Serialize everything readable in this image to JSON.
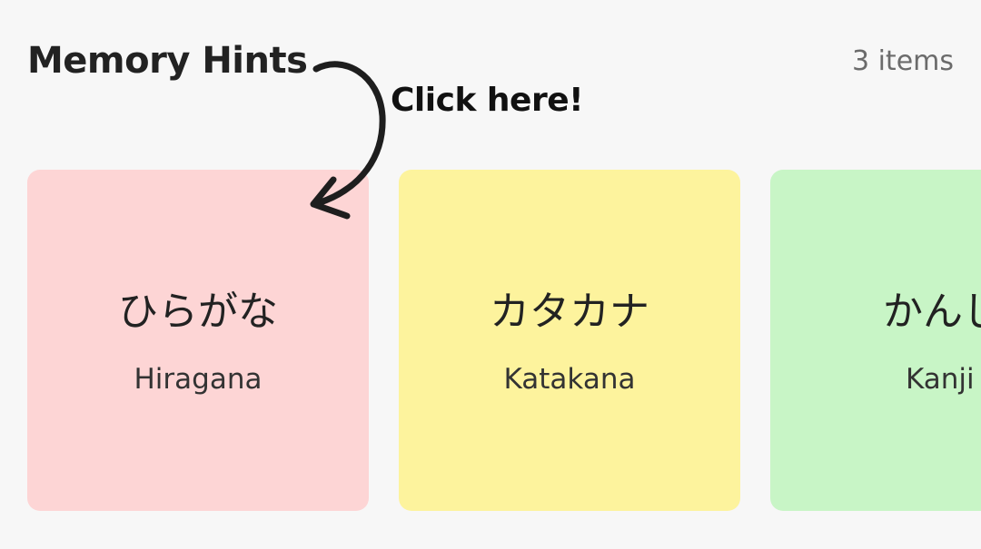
{
  "header": {
    "title": "Memory Hints",
    "count_label": "3 items"
  },
  "callout": {
    "text": "Click here!"
  },
  "cards": [
    {
      "kana": "ひらがな",
      "label": "Hiragana",
      "color": "#fdd5d5"
    },
    {
      "kana": "カタカナ",
      "label": "Katakana",
      "color": "#fdf39d"
    },
    {
      "kana": "かんじ",
      "label": "Kanji",
      "color": "#c8f5c6"
    }
  ]
}
